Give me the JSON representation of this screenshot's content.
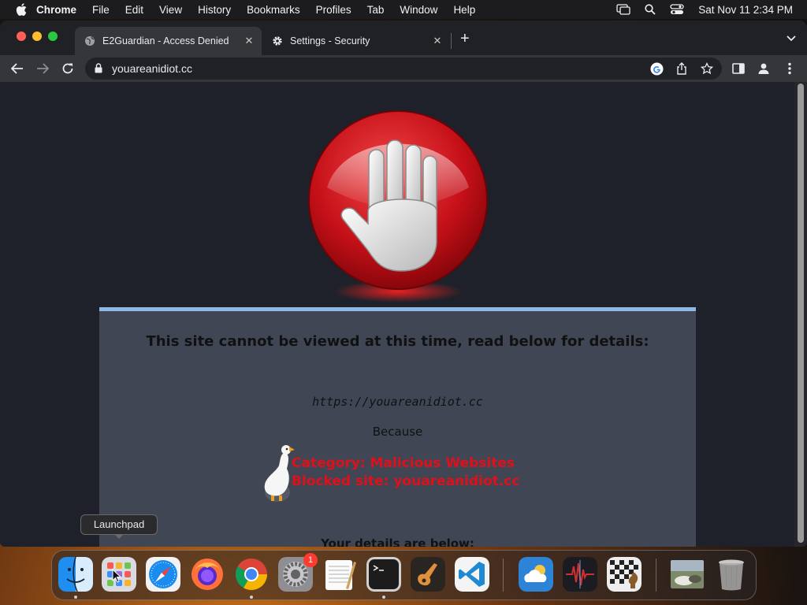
{
  "menubar": {
    "app_name": "Chrome",
    "menus": [
      "File",
      "Edit",
      "View",
      "History",
      "Bookmarks",
      "Profiles",
      "Tab",
      "Window",
      "Help"
    ],
    "clock": "Sat Nov 11  2:34 PM"
  },
  "browser": {
    "tabs": [
      {
        "title": "E2Guardian - Access Denied",
        "icon": "globe-icon",
        "active": true
      },
      {
        "title": "Settings - Security",
        "icon": "gear-icon",
        "active": false
      }
    ],
    "address_bar": {
      "url": "youareanidiot.cc"
    }
  },
  "page": {
    "heading": "This site cannot be viewed at this time, read below for details:",
    "blocked_url": "https://youareanidiot.cc",
    "because_label": "Because",
    "category_line": "Category: Malicious Websites",
    "blocked_line": "Blocked site: youareanidiot.cc",
    "details_heading": "Your details are below:"
  },
  "tooltip": {
    "text": "Launchpad"
  },
  "dock": {
    "items": [
      "Finder",
      "Launchpad",
      "Safari",
      "Firefox",
      "Google Chrome",
      "System Preferences",
      "TextEdit",
      "Terminal",
      "GarageBand",
      "Visual Studio Code",
      "Weather",
      "Audio Hijack",
      "Chess",
      "Photos",
      "Trash"
    ],
    "system_preferences_badge": "1"
  },
  "colors": {
    "card_border": "#90b8e4",
    "reason_text": "#e0101a",
    "page_background": "#1e2129"
  }
}
